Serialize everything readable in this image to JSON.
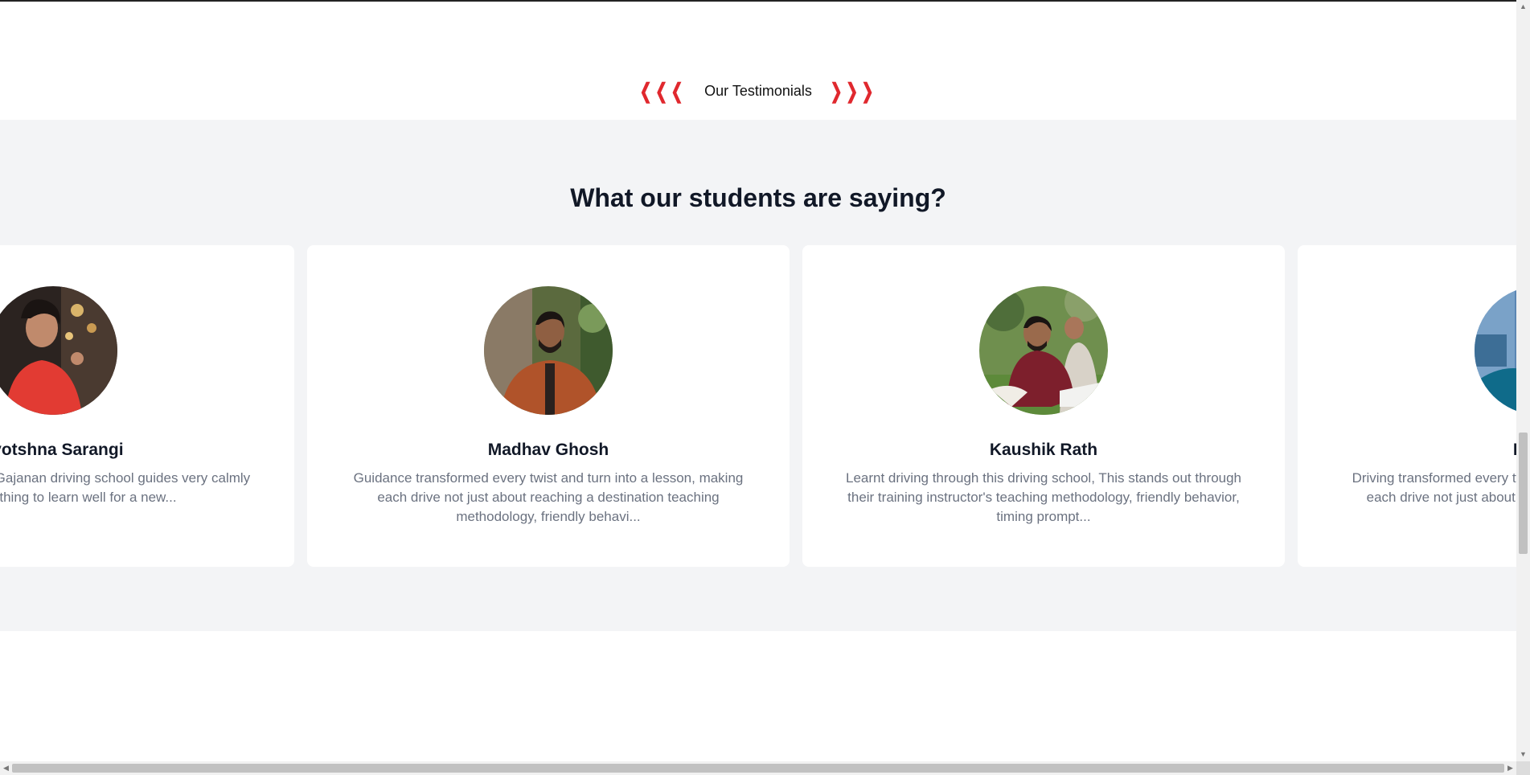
{
  "section": {
    "eyebrow": "Our Testimonials",
    "heading": "What our students are saying?"
  },
  "icons": {
    "left": "chevron-left-icon",
    "right": "chevron-right-icon",
    "accent": "#e0282e"
  },
  "testimonials": [
    {
      "name": "Jyotshna Sarangi",
      "quote": "My trainer Mr.Tapas of Gajanan driving school guides very calmly is the main thing to learn well for a new..."
    },
    {
      "name": "Madhav Ghosh",
      "quote": "Guidance transformed every twist and turn into a lesson, making each drive not just about reaching a destination teaching methodology, friendly behavi..."
    },
    {
      "name": "Kaushik Rath",
      "quote": "Learnt driving through this driving school, This stands out through their training instructor's teaching methodology, friendly behavior, timing prompt..."
    },
    {
      "name": "Ritesh",
      "quote": "Driving transformed every twist and turn into a lesson, making each drive not just about reaching a destination friendly..."
    }
  ]
}
